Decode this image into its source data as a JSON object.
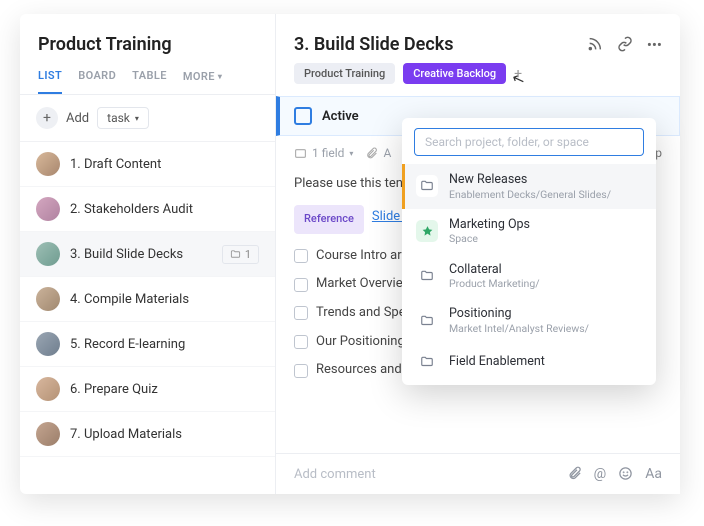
{
  "sidebar": {
    "title": "Product Training",
    "tabs": [
      "LIST",
      "BOARD",
      "TABLE",
      "MORE"
    ],
    "add_label": "Add",
    "task_label": "task",
    "items": [
      {
        "label": "1. Draft Content"
      },
      {
        "label": "2. Stakeholders Audit"
      },
      {
        "label": "3. Build Slide Decks",
        "folder_count": "1",
        "selected": true
      },
      {
        "label": "4. Compile Materials"
      },
      {
        "label": "5. Record E-learning"
      },
      {
        "label": "6. Prepare Quiz"
      },
      {
        "label": "7. Upload Materials"
      }
    ]
  },
  "detail": {
    "title": "3. Build Slide Decks",
    "tags": {
      "product_training": "Product Training",
      "creative_backlog": "Creative Backlog"
    },
    "status_label": "Active",
    "meta": {
      "field": "1 field",
      "attach": "A",
      "truncated_suffix": "up"
    },
    "intro": "Please use this ten",
    "reference_label": "Reference",
    "slide_link": "Slide D",
    "checklist": [
      "Course Intro ar",
      "Market Overvie",
      "Trends and Spe",
      "Our Positioning",
      "Resources and Contacts"
    ],
    "comment_placeholder": "Add comment"
  },
  "popover": {
    "search_placeholder": "Search project, folder, or space",
    "items": [
      {
        "title": "New Releases",
        "subtitle": "Enablement Decks/General Slides/",
        "icon": "folder",
        "selected": true
      },
      {
        "title": "Marketing Ops",
        "subtitle": "Space",
        "icon": "space"
      },
      {
        "title": "Collateral",
        "subtitle": "Product Marketing/",
        "icon": "folder"
      },
      {
        "title": "Positioning",
        "subtitle": "Market Intel/Analyst Reviews/",
        "icon": "folder"
      },
      {
        "title": "Field Enablement",
        "subtitle": "",
        "icon": "folder"
      }
    ]
  }
}
